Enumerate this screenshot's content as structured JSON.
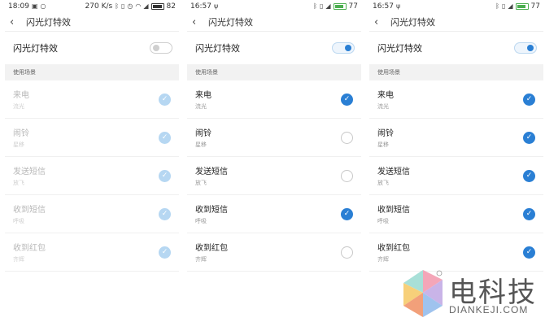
{
  "panels": [
    {
      "status": {
        "time": "18:09",
        "net_speed": "270 K/s",
        "battery": "82",
        "battery_fill": 0.82,
        "battery_color": "#333333"
      },
      "title": "闪光灯特效",
      "toggle_label": "闪光灯特效",
      "toggle_on": false,
      "section_label": "使用场景",
      "items": [
        {
          "title": "来电",
          "sub": "流光",
          "checked": true
        },
        {
          "title": "闹铃",
          "sub": "星移",
          "checked": true
        },
        {
          "title": "发送短信",
          "sub": "放飞",
          "checked": true
        },
        {
          "title": "收到短信",
          "sub": "呼吸",
          "checked": true
        },
        {
          "title": "收到红包",
          "sub": "齐辉",
          "checked": true
        }
      ]
    },
    {
      "status": {
        "time": "16:57",
        "battery": "77",
        "battery_fill": 0.77,
        "battery_color": "#4caf50"
      },
      "title": "闪光灯特效",
      "toggle_label": "闪光灯特效",
      "toggle_on": true,
      "section_label": "使用场景",
      "items": [
        {
          "title": "来电",
          "sub": "流光",
          "checked": true
        },
        {
          "title": "闹铃",
          "sub": "星移",
          "checked": false
        },
        {
          "title": "发送短信",
          "sub": "放飞",
          "checked": false
        },
        {
          "title": "收到短信",
          "sub": "呼吸",
          "checked": true
        },
        {
          "title": "收到红包",
          "sub": "齐辉",
          "checked": false
        }
      ]
    },
    {
      "status": {
        "time": "16:57",
        "battery": "77",
        "battery_fill": 0.77,
        "battery_color": "#4caf50"
      },
      "title": "闪光灯特效",
      "toggle_label": "闪光灯特效",
      "toggle_on": true,
      "section_label": "使用场景",
      "items": [
        {
          "title": "来电",
          "sub": "流光",
          "checked": true
        },
        {
          "title": "闹铃",
          "sub": "星移",
          "checked": true
        },
        {
          "title": "发送短信",
          "sub": "放飞",
          "checked": true
        },
        {
          "title": "收到短信",
          "sub": "呼吸",
          "checked": true
        },
        {
          "title": "收到红包",
          "sub": "齐辉",
          "checked": true
        }
      ]
    }
  ],
  "colors": {
    "accent": "#2a7fd4",
    "accent_dim": "#b6d7f2",
    "section_bg": "#f2f2f2"
  },
  "icons": {
    "back": "back-arrow-icon",
    "check": "check-icon"
  },
  "watermark": {
    "name": "电科技",
    "domain": "DIANKEJI.COM"
  }
}
